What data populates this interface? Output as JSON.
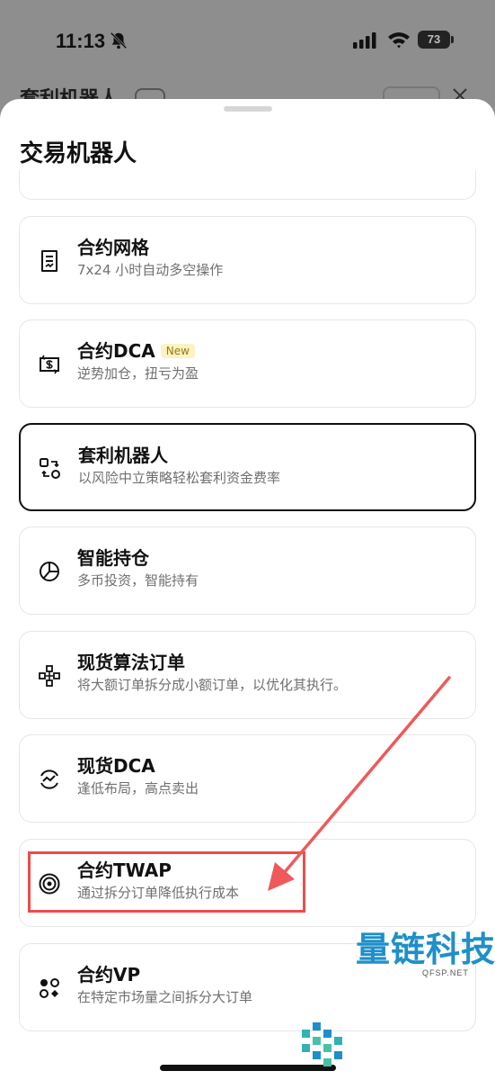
{
  "status_bar": {
    "time": "11:13",
    "battery": "73",
    "icons": [
      "bell-slash-icon",
      "signal-icon",
      "wifi-icon",
      "battery-icon"
    ]
  },
  "background": {
    "title": "套利机器人"
  },
  "sheet": {
    "title": "交易机器人",
    "items": [
      {
        "title": "合约网格",
        "desc": "7x24 小时自动多空操作",
        "icon": "grid-doc-icon"
      },
      {
        "title": "合约DCA",
        "badge": "New",
        "desc": "逆势加仓，扭亏为盈",
        "icon": "dollar-refresh-icon"
      },
      {
        "title": "套利机器人",
        "desc": "以风险中立策略轻松套利资金费率",
        "icon": "arbitrage-icon",
        "selected": true
      },
      {
        "title": "智能持仓",
        "desc": "多币投资，智能持有",
        "icon": "pie-chart-icon"
      },
      {
        "title": "现货算法订单",
        "desc": "将大额订单拆分成小额订单，以优化其执行。",
        "icon": "nodes-icon"
      },
      {
        "title": "现货DCA",
        "desc": "逢低布局，高点卖出",
        "icon": "trend-cycle-icon"
      },
      {
        "title": "合约TWAP",
        "desc": "通过拆分订单降低执行成本",
        "icon": "target-icon"
      },
      {
        "title": "合约VP",
        "desc": "在特定市场量之间拆分大订单",
        "icon": "dots-cluster-icon"
      }
    ]
  },
  "watermark": {
    "text": "量链科技",
    "sub": "QFSP.NET"
  },
  "colors": {
    "highlight": "#ee4b4b",
    "badge_bg": "#fbf3c4",
    "badge_text": "#9a7b0c",
    "watermark": "#1f8fc9"
  }
}
